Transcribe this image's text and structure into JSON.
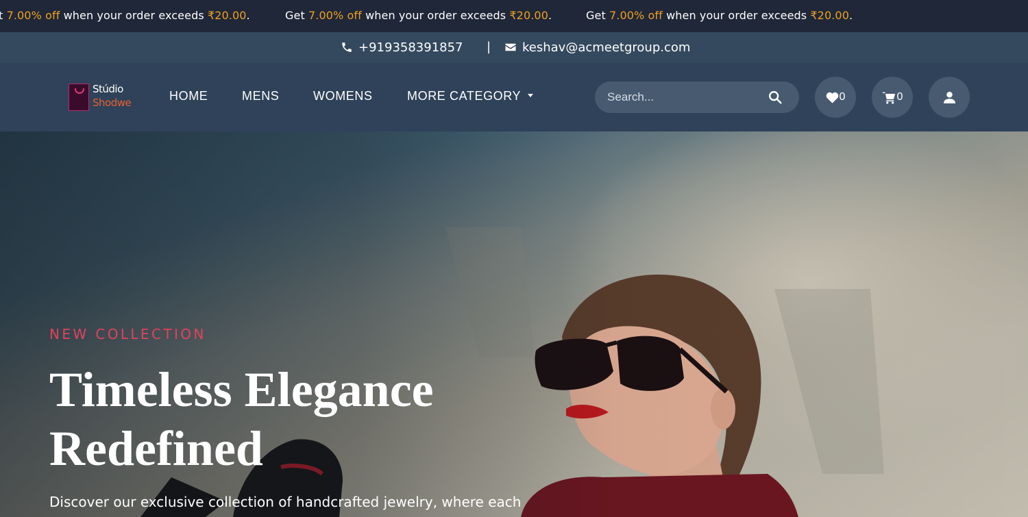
{
  "promo": {
    "prefix": "Get ",
    "highlight": "7.00% off",
    "suffix": " when your order exceeds ",
    "amount": "₹20.00",
    "end": ".",
    "partial_first": "t "
  },
  "contact": {
    "phone": "+919358391857",
    "separator": "|",
    "email": "keshav@acmeetgroup.com"
  },
  "brand": {
    "line1": "Stúdio",
    "line2": "Shodwe"
  },
  "nav": {
    "home": "HOME",
    "mens": "MENS",
    "womens": "WOMENS",
    "more": "MORE CATEGORY"
  },
  "search": {
    "placeholder": "Search..."
  },
  "header_actions": {
    "wishlist_count": "0",
    "cart_count": "0"
  },
  "hero": {
    "eyebrow": "NEW COLLECTION",
    "title_line1": "Timeless Elegance",
    "title_line2": "Redefined",
    "description": "Discover our exclusive collection of handcrafted jewelry, where each"
  },
  "colors": {
    "ticker_bg": "#1f2738",
    "ticker_highlight": "#f0a021",
    "contact_bg": "#34495e",
    "header_bg": "#2f4259",
    "accent_red": "#e2435d",
    "logo_orange": "#e8602c"
  },
  "icons": [
    "phone-icon",
    "mail-icon",
    "search-icon",
    "heart-icon",
    "cart-icon",
    "user-icon",
    "shopping-bag-logo-icon",
    "caret-down-icon"
  ]
}
